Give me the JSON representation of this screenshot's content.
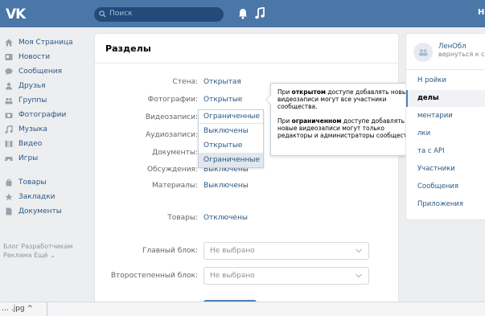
{
  "header": {
    "logo": "VK",
    "search_placeholder": "Поиск",
    "right_text": "Н",
    "icons": [
      "search-icon",
      "bell-icon",
      "music-icon"
    ]
  },
  "leftmenu": {
    "items": [
      {
        "label": "Моя Страница",
        "icon": "home-icon"
      },
      {
        "label": "Новости",
        "icon": "news-icon"
      },
      {
        "label": "Сообщения",
        "icon": "messages-icon"
      },
      {
        "label": "Друзья",
        "icon": "friends-icon"
      },
      {
        "label": "Группы",
        "icon": "groups-icon"
      },
      {
        "label": "Фотографии",
        "icon": "camera-icon"
      },
      {
        "label": "Музыка",
        "icon": "music-icon"
      },
      {
        "label": "Видео",
        "icon": "video-icon"
      },
      {
        "label": "Игры",
        "icon": "games-icon"
      }
    ],
    "items2": [
      {
        "label": "Товары",
        "icon": "bag-icon"
      },
      {
        "label": "Закладки",
        "icon": "star-icon"
      },
      {
        "label": "Документы",
        "icon": "document-icon"
      }
    ],
    "footer_line1": "Блог  Разработчикам",
    "footer_line2": "Реклама  Ещё ⌄"
  },
  "main": {
    "title": "Разделы",
    "rows": [
      {
        "label": "Стена:",
        "value": "Открытая"
      },
      {
        "label": "Фотографии:",
        "value": "Открытые"
      },
      {
        "label": "Видеозаписи:",
        "value": ""
      },
      {
        "label": "Аудиозаписи:",
        "value": ""
      },
      {
        "label": "Документы:",
        "value": ""
      },
      {
        "label": "Обсуждения:",
        "value": "Выключены"
      },
      {
        "label": "Материалы:",
        "value": "Выключены"
      }
    ],
    "goods_label": "Товары:",
    "goods_value": "Отключены",
    "main_block_label": "Главный блок:",
    "main_block_value": "Не выбрано",
    "secondary_block_label": "Второстепенный блок:",
    "secondary_block_value": "Не выбрано"
  },
  "dropdown": {
    "current": "Ограниченные",
    "options": [
      "Выключены",
      "Открытые",
      "Ограниченные"
    ],
    "selected_index": 2
  },
  "tooltip": {
    "p1_before": "При ",
    "p1_bold": "открытом",
    "p1_after": " доступе добавлять новые видеозаписи могут все участники сообщества.",
    "p2_before": "При ",
    "p2_bold": "ограниченном",
    "p2_after": " доступе добавлять новые видеозаписи могут только редакторы и администраторы сообщества."
  },
  "rightpanel": {
    "name": "ЛенОбл",
    "back": "вернуться к ст",
    "items": [
      "Настройки",
      "Разделы",
      "Комментарии",
      "Ссылки",
      "Работа с API",
      "Участники",
      "Сообщения",
      "Приложения"
    ],
    "visible_items": [
      "Н    ройки",
      "    делы",
      "   ментарии",
      "    лки",
      "    та с API",
      "Участники",
      "Сообщения",
      "Приложения"
    ],
    "active_index": 1
  },
  "bottombar": {
    "text": "… .jpg  ^"
  },
  "colors": {
    "header_bg": "#4a76a8",
    "link": "#2a5885",
    "accent": "#5181b8",
    "page_bg": "#edeef0"
  }
}
